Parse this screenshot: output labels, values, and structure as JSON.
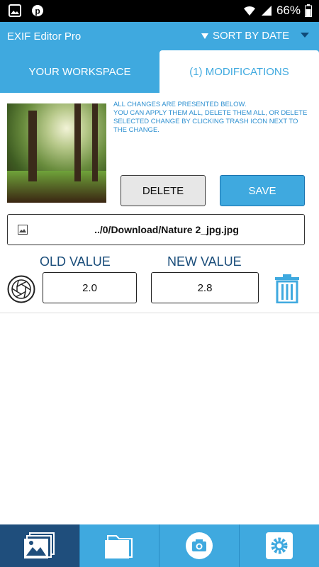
{
  "status": {
    "battery": "66%"
  },
  "app": {
    "title": "EXIF Editor Pro",
    "sort_label": "SORT BY DATE"
  },
  "tabs": [
    {
      "label": "YOUR WORKSPACE"
    },
    {
      "label": "(1) MODIFICATIONS"
    }
  ],
  "info": {
    "line1": "ALL CHANGES ARE PRESENTED BELOW.",
    "line2": "YOU CAN APPLY THEM ALL, DELETE THEM ALL, OR DELETE SELECTED CHANGE BY CLICKING TRASH ICON NEXT TO THE CHANGE."
  },
  "actions": {
    "delete_label": "DELETE",
    "save_label": "SAVE"
  },
  "file": {
    "path": "../0/Download/Nature 2_jpg.jpg"
  },
  "change": {
    "old_label": "OLD VALUE",
    "new_label": "NEW VALUE",
    "old_value": "2.0",
    "new_value": "2.8"
  },
  "colors": {
    "accent": "#3fa9df",
    "nav_active": "#1f4e7c",
    "text_blue": "#2c8fd0"
  },
  "bottom_nav": [
    {
      "icon": "gallery-icon"
    },
    {
      "icon": "folder-icon"
    },
    {
      "icon": "camera-icon"
    },
    {
      "icon": "settings-icon"
    }
  ]
}
